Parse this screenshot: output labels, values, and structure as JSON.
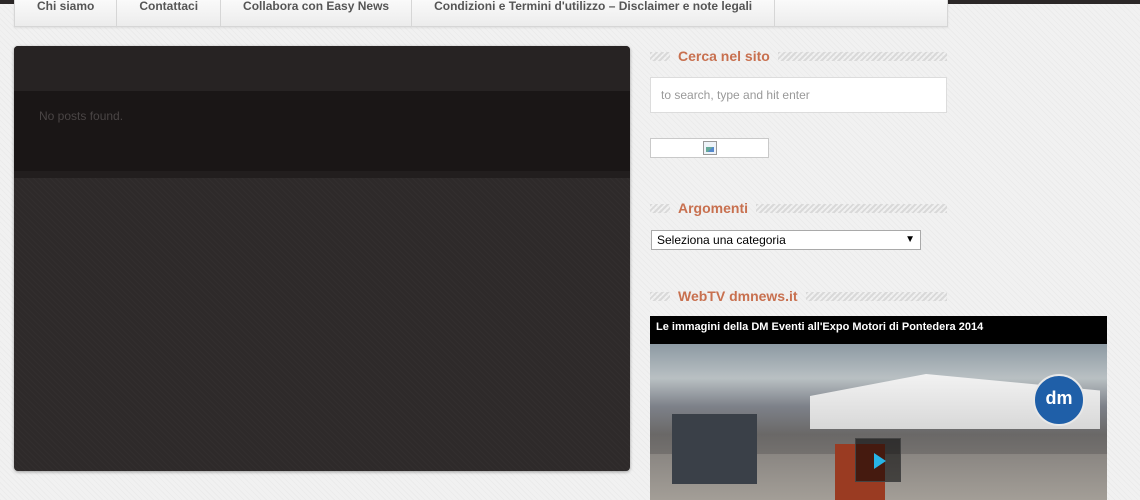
{
  "nav": {
    "items": [
      "Chi siamo",
      "Contattaci",
      "Collabora con Easy News",
      "Condizioni e Termini d'utilizzo – Disclaimer e note legali"
    ]
  },
  "main": {
    "empty_message": "No posts found."
  },
  "sidebar": {
    "search": {
      "title": "Cerca nel sito",
      "placeholder": "to search, type and hit enter"
    },
    "categories": {
      "title": "Argomenti",
      "selected": "Seleziona una categoria"
    },
    "webtv": {
      "title": "WebTV dmnews.it",
      "video_title": "Le immagini della DM Eventi all'Expo Motori di Pontedera 2014",
      "logo_text": "dm"
    }
  },
  "colors": {
    "accent": "#c8704f",
    "panel": "#2e2a2a",
    "topbar": "#2b2727"
  }
}
